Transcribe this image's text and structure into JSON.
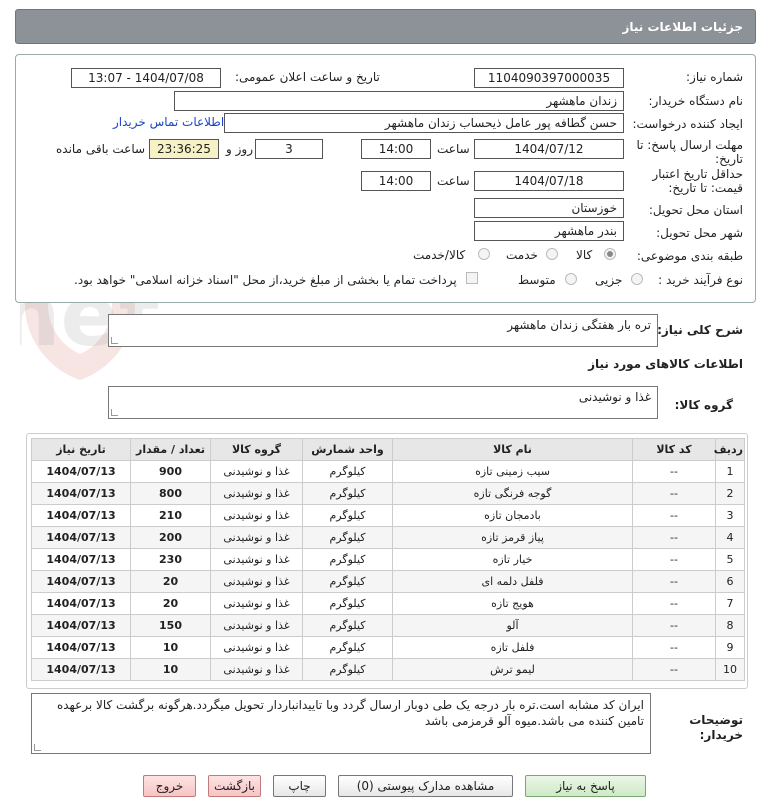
{
  "header": {
    "title": "جزئیات اطلاعات نیاز"
  },
  "form": {
    "need_number": {
      "label": "شماره نیاز:",
      "value": "1104090397000035"
    },
    "announce_datetime": {
      "label": "تاریخ و ساعت اعلان عمومی:",
      "value": "1404/07/08 - 13:07"
    },
    "buyer_org": {
      "label": "نام دستگاه خریدار:",
      "value": "زندان ماهشهر"
    },
    "requester": {
      "label": "ایجاد کننده درخواست:",
      "value": "حسن گطافه پور عامل ذیحساب زندان ماهشهر",
      "contact_link": "اطلاعات تماس خریدار"
    },
    "reply_deadline": {
      "label": "مهلت ارسال پاسخ: تا تاریخ:",
      "date": "1404/07/12",
      "time_label": "ساعت",
      "time": "14:00",
      "days": "3",
      "days_label": "روز و",
      "remaining": "23:36:25",
      "remaining_label": "ساعت باقی مانده"
    },
    "price_validity": {
      "label": "حداقل تاریخ اعتبار قیمت: تا تاریخ:",
      "date": "1404/07/18",
      "time_label": "ساعت",
      "time": "14:00"
    },
    "province": {
      "label": "استان محل تحویل:",
      "value": "خوزستان"
    },
    "city": {
      "label": "شهر محل تحویل:",
      "value": "بندر ماهشهر"
    },
    "category": {
      "label": "طبقه بندی موضوعی:",
      "options": [
        "کالا",
        "خدمت",
        "کالا/خدمت"
      ],
      "selected": "کالا"
    },
    "process_type": {
      "label": "نوع فرآیند خرید :",
      "options": [
        "جزیی",
        "متوسط"
      ],
      "payment_note": "پرداخت تمام یا بخشی از مبلغ خرید،از محل \"اسناد خزانه اسلامی\" خواهد بود."
    }
  },
  "description": {
    "label": "شرح کلی نیاز:",
    "value": "تره بار هفتگی زندان ماهشهر"
  },
  "goods_section": {
    "title": "اطلاعات کالاهای مورد نیاز",
    "group_label": "گروه کالا:",
    "group_value": "غذا و نوشیدنی"
  },
  "table": {
    "headers": [
      "ردیف",
      "کد کالا",
      "نام کالا",
      "واحد شمارش",
      "گروه کالا",
      "تعداد / مقدار",
      "تاریخ نیاز"
    ],
    "rows": [
      [
        "1",
        "--",
        "سیب زمینی تازه",
        "کیلوگرم",
        "غذا و نوشیدنی",
        "900",
        "1404/07/13"
      ],
      [
        "2",
        "--",
        "گوجه فرنگی تازه",
        "کیلوگرم",
        "غذا و نوشیدنی",
        "800",
        "1404/07/13"
      ],
      [
        "3",
        "--",
        "بادمجان تازه",
        "کیلوگرم",
        "غذا و نوشیدنی",
        "210",
        "1404/07/13"
      ],
      [
        "4",
        "--",
        "پیاز قرمز تازه",
        "کیلوگرم",
        "غذا و نوشیدنی",
        "200",
        "1404/07/13"
      ],
      [
        "5",
        "--",
        "خیار تازه",
        "کیلوگرم",
        "غذا و نوشیدنی",
        "230",
        "1404/07/13"
      ],
      [
        "6",
        "--",
        "فلفل دلمه ای",
        "کیلوگرم",
        "غذا و نوشیدنی",
        "20",
        "1404/07/13"
      ],
      [
        "7",
        "--",
        "هویج تازه",
        "کیلوگرم",
        "غذا و نوشیدنی",
        "20",
        "1404/07/13"
      ],
      [
        "8",
        "--",
        "آلو",
        "کیلوگرم",
        "غذا و نوشیدنی",
        "150",
        "1404/07/13"
      ],
      [
        "9",
        "--",
        "فلفل تازه",
        "کیلوگرم",
        "غذا و نوشیدنی",
        "10",
        "1404/07/13"
      ],
      [
        "10",
        "--",
        "لیمو ترش",
        "کیلوگرم",
        "غذا و نوشیدنی",
        "10",
        "1404/07/13"
      ]
    ]
  },
  "buyer_notes": {
    "label": "توضیحات خریدار:",
    "value": "ایران کد مشابه است.تره بار درجه یک طی دوبار ارسال گردد وبا تاییدانباردار تحویل میگردد.هرگونه برگشت کالا برعهده تامین کننده می باشد.میوه آلو قرمزمی باشد"
  },
  "buttons": {
    "reply": "پاسخ به نیاز",
    "attachments": "مشاهده مدارک پیوستی (0)",
    "print": "چاپ",
    "back": "بازگشت",
    "exit": "خروج"
  },
  "watermark": {
    "text": "AriaTender.net"
  },
  "colors": {
    "header_bg": "#8c9298",
    "link": "#1a45c8",
    "remaining_bg": "#f6f2c6"
  }
}
